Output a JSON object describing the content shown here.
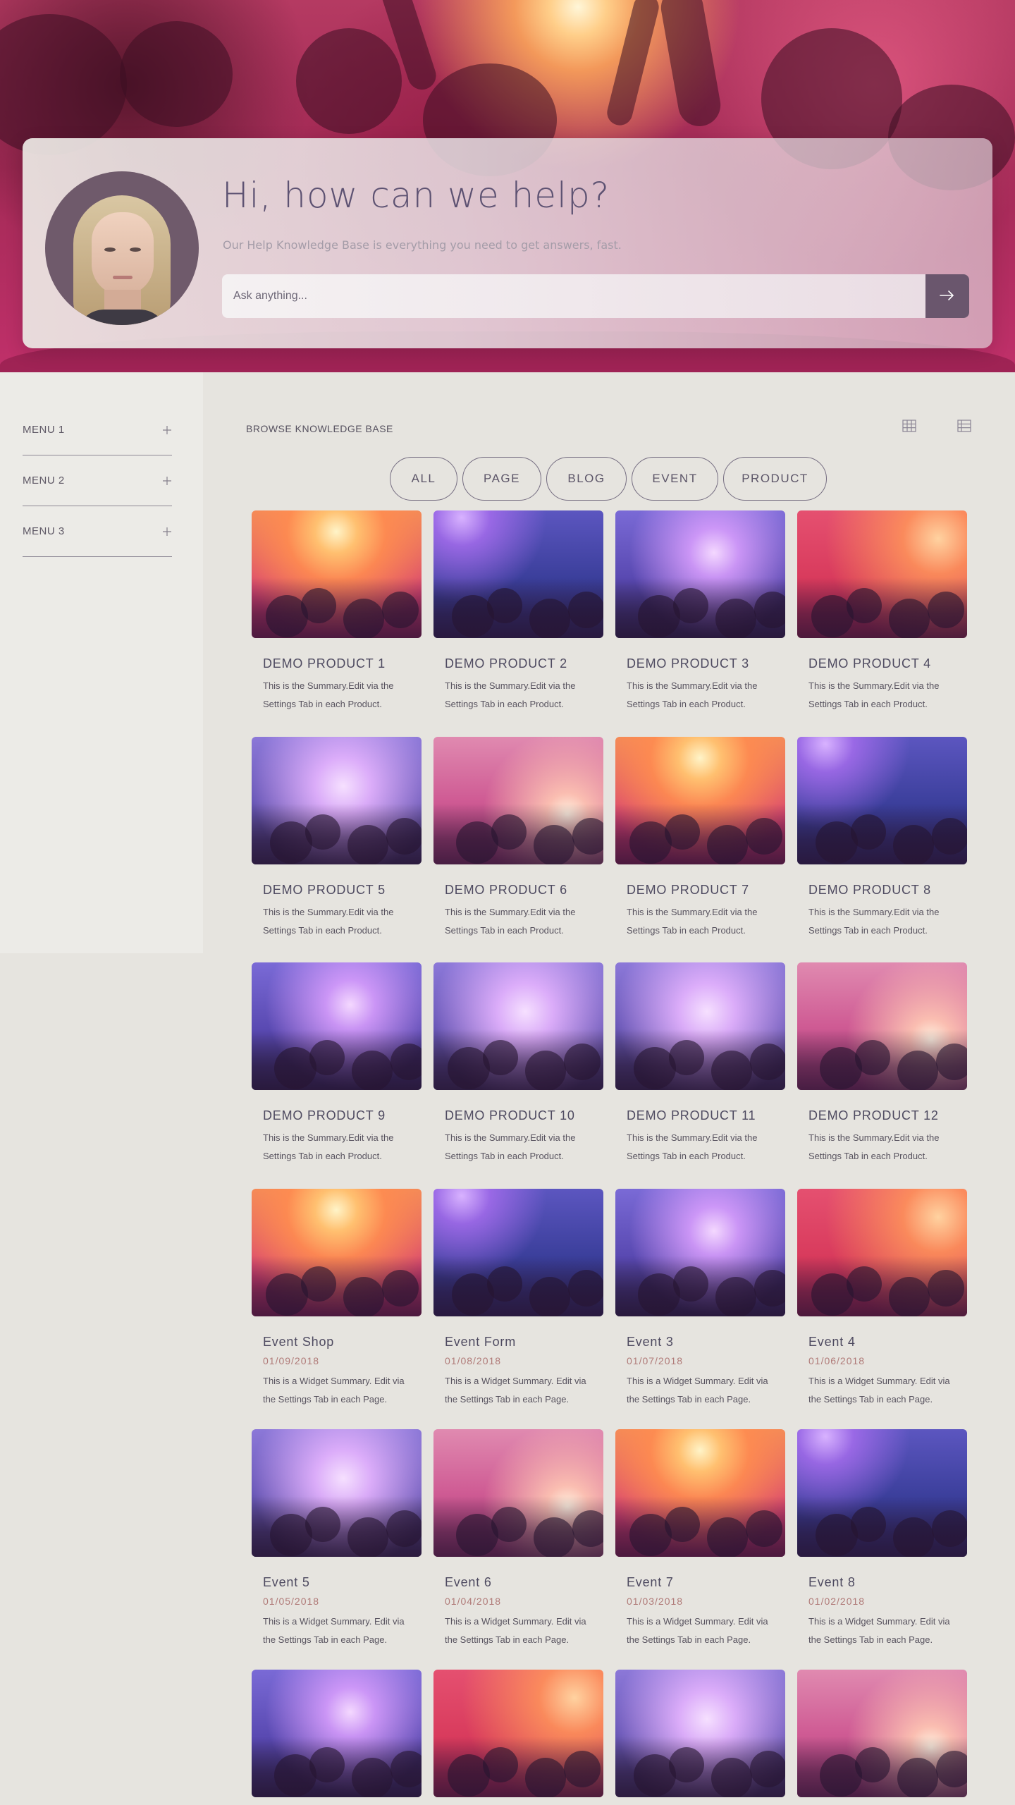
{
  "hero": {
    "title": "Hi, how can we help?",
    "subtitle": "Our Help Knowledge Base is everything you need to get answers, fast.",
    "search": {
      "placeholder": "Ask anything..."
    }
  },
  "sidebar": {
    "items": [
      {
        "label": "MENU 1"
      },
      {
        "label": "MENU 2"
      },
      {
        "label": "MENU 3"
      }
    ]
  },
  "main": {
    "browse_title": "BROWSE KNOWLEDGE BASE",
    "filters": [
      "ALL",
      "PAGE",
      "BLOG",
      "EVENT",
      "PRODUCT"
    ],
    "cards": [
      {
        "title": "DEMO PRODUCT 1",
        "summary": "This is the Summary.Edit via the Settings Tab in each Product.",
        "image": "t-warm"
      },
      {
        "title": "DEMO PRODUCT 2",
        "summary": "This is the Summary.Edit via the Settings Tab in each Product.",
        "image": "t-blue"
      },
      {
        "title": "DEMO PRODUCT 3",
        "summary": "This is the Summary.Edit via the Settings Tab in each Product.",
        "image": "t-violet"
      },
      {
        "title": "DEMO PRODUCT 4",
        "summary": "This is the Summary.Edit via the Settings Tab in each Product.",
        "image": "t-red"
      },
      {
        "title": "DEMO PRODUCT 5",
        "summary": "This is the Summary.Edit via the Settings Tab in each Product.",
        "image": "t-lav"
      },
      {
        "title": "DEMO PRODUCT 6",
        "summary": "This is the Summary.Edit via the Settings Tab in each Product.",
        "image": "t-pink"
      },
      {
        "title": "DEMO PRODUCT 7",
        "summary": "This is the Summary.Edit via the Settings Tab in each Product.",
        "image": "t-warm"
      },
      {
        "title": "DEMO PRODUCT 8",
        "summary": "This is the Summary.Edit via the Settings Tab in each Product.",
        "image": "t-blue"
      },
      {
        "title": "DEMO PRODUCT 9",
        "summary": "This is the Summary.Edit via the Settings Tab in each Product.",
        "image": "t-violet"
      },
      {
        "title": "DEMO PRODUCT 10",
        "summary": "This is the Summary.Edit via the Settings Tab in each Product.",
        "image": "t-lav"
      },
      {
        "title": "DEMO PRODUCT 11",
        "summary": "This is the Summary.Edit via the Settings Tab in each Product.",
        "image": "t-lav"
      },
      {
        "title": "DEMO PRODUCT 12",
        "summary": "This is the Summary.Edit via the Settings Tab in each Product.",
        "image": "t-pink"
      },
      {
        "title": "Event Shop",
        "date": "01/09/2018",
        "summary": "This is a Widget Summary. Edit via the Settings Tab in each Page.",
        "image": "t-warm"
      },
      {
        "title": "Event Form",
        "date": "01/08/2018",
        "summary": "This is a Widget Summary. Edit via the Settings Tab in each Page.",
        "image": "t-blue"
      },
      {
        "title": "Event 3",
        "date": "01/07/2018",
        "summary": "This is a Widget Summary. Edit via the Settings Tab in each Page.",
        "image": "t-violet"
      },
      {
        "title": "Event 4",
        "date": "01/06/2018",
        "summary": "This is a Widget Summary. Edit via the Settings Tab in each Page.",
        "image": "t-red"
      },
      {
        "title": "Event 5",
        "date": "01/05/2018",
        "summary": "This is a Widget Summary. Edit via the Settings Tab in each Page.",
        "image": "t-lav"
      },
      {
        "title": "Event 6",
        "date": "01/04/2018",
        "summary": "This is a Widget Summary. Edit via the Settings Tab in each Page.",
        "image": "t-pink"
      },
      {
        "title": "Event 7",
        "date": "01/03/2018",
        "summary": "This is a Widget Summary. Edit via the Settings Tab in each Page.",
        "image": "t-warm"
      },
      {
        "title": "Event 8",
        "date": "01/02/2018",
        "summary": "This is a Widget Summary. Edit via the Settings Tab in each Page.",
        "image": "t-blue"
      },
      {
        "title": "",
        "summary": "",
        "image": "t-violet"
      },
      {
        "title": "",
        "summary": "",
        "image": "t-red"
      },
      {
        "title": "",
        "summary": "",
        "image": "t-lav"
      },
      {
        "title": "",
        "summary": "",
        "image": "t-pink"
      }
    ]
  },
  "icons": {
    "search_button": "arrow-right-icon",
    "menu_toggle": "plus-icon",
    "view_grid": "grid-view-icon",
    "view_list": "list-view-icon"
  },
  "colors": {
    "accent": "#6a566d",
    "date": "#b07a78",
    "title": "#5d5272"
  }
}
